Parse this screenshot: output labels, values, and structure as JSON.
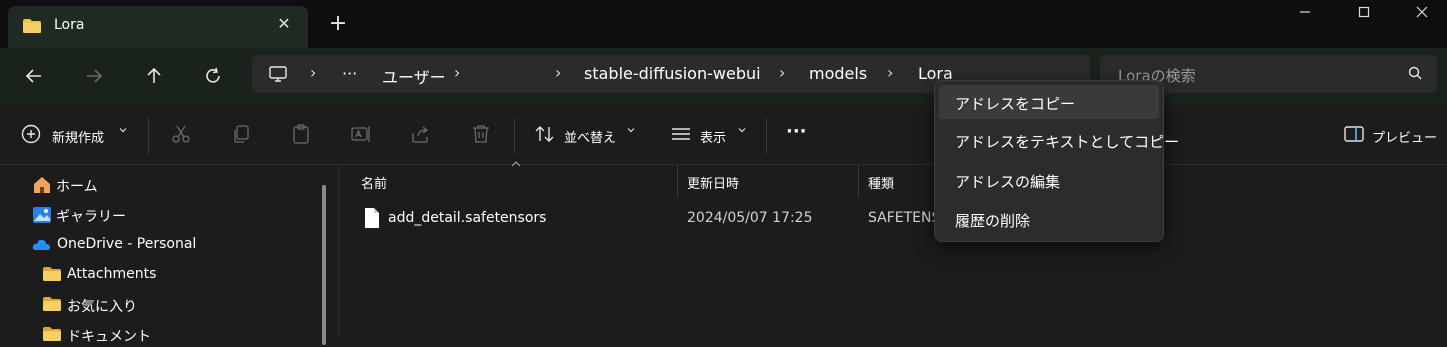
{
  "window": {
    "tab_title": "Lora",
    "new_tab_glyph": "+",
    "close_glyph": "✕"
  },
  "nav": {
    "back_icon": "back-arrow-icon",
    "forward_icon": "forward-arrow-icon",
    "up_icon": "up-arrow-icon",
    "refresh_icon": "refresh-icon"
  },
  "address": {
    "overflow": "···",
    "crumbs": [
      "ユーザー",
      "stable-diffusion-webui",
      "models",
      "Lora"
    ],
    "separator": "›"
  },
  "search": {
    "placeholder": "Loraの検索"
  },
  "toolbar": {
    "new_label": "新規作成",
    "sort_label": "並べ替え",
    "view_label": "表示",
    "more_label": "···",
    "preview_label": "プレビュー"
  },
  "sidebar": {
    "items": [
      {
        "label": "ホーム",
        "icon": "home-icon"
      },
      {
        "label": "ギャラリー",
        "icon": "gallery-icon"
      },
      {
        "label": "OneDrive - Personal",
        "icon": "cloud-icon"
      },
      {
        "label": "Attachments",
        "icon": "folder-icon"
      },
      {
        "label": "お気に入り",
        "icon": "folder-icon"
      },
      {
        "label": "ドキュメント",
        "icon": "folder-icon"
      }
    ]
  },
  "columns": {
    "name": "名前",
    "modified": "更新日時",
    "type": "種類"
  },
  "files": [
    {
      "name": "add_detail.safetensors",
      "modified": "2024/05/07 17:25",
      "type": "SAFETENS"
    }
  ],
  "context_menu": {
    "items": [
      {
        "label": "アドレスをコピー"
      },
      {
        "label": "アドレスをテキストとしてコピー"
      },
      {
        "label": "アドレスの編集"
      },
      {
        "label": "履歴の削除"
      }
    ]
  },
  "colors": {
    "folder": "#f2c14e",
    "accent": "#4cc2ff",
    "background": "#1c1c1c"
  }
}
